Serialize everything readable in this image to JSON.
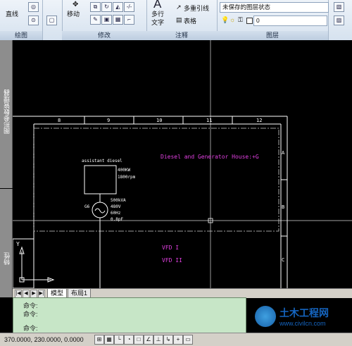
{
  "ribbon": {
    "draw": {
      "line_label": "直线",
      "title": "绘图"
    },
    "modify": {
      "move_label": "移动",
      "title": "修改"
    },
    "annotation": {
      "text_label": "多行",
      "text_label2": "文字",
      "mleader_label": "多重引线",
      "table_label": "表格",
      "title": "注释"
    },
    "layers": {
      "state_value": "未保存的图层状态",
      "layer_value": "0",
      "title": "图层"
    }
  },
  "palettes": {
    "sheet_set": "图形参数管理器",
    "properties": "特性"
  },
  "drawing": {
    "columns": [
      "8",
      "9",
      "10",
      "11",
      "12"
    ],
    "rows": [
      "A",
      "B",
      "C"
    ],
    "title_text": "Diesel and Generator House:+G",
    "diesel_label": "assistant diesel",
    "motor_spec": [
      "400KW",
      "1800rpm"
    ],
    "gen_label": "G6",
    "gen_spec": [
      "500kVA",
      "480V",
      "60Hz",
      "0.8pF"
    ],
    "vfd1": "VFD I",
    "vfd2": "VFD II",
    "ucs_y": "Y",
    "text_color": "#e040e0",
    "line_color": "#ffffff"
  },
  "tabs": {
    "model": "模型",
    "layout1": "布局1"
  },
  "command": {
    "lines": [
      "命令:",
      "命令:",
      "命令:"
    ]
  },
  "status": {
    "coords": "370.0000,  230.0000,  0.0000"
  },
  "watermark": {
    "name": "土木工程网",
    "url": "www.civilcn.com"
  }
}
